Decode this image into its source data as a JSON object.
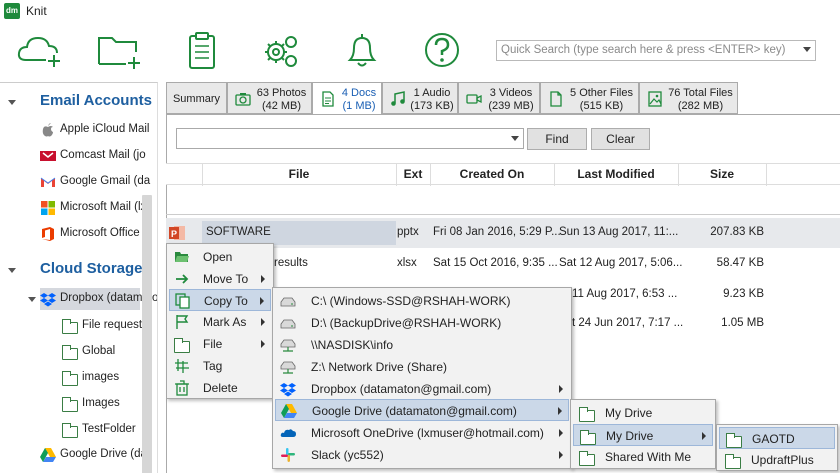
{
  "app": {
    "title": "Knit",
    "logo_text": "dm"
  },
  "search": {
    "placeholder": "Quick Search   (type search here & press <ENTER> key)"
  },
  "toolbar": {
    "icons": [
      "cloud-add-icon",
      "folder-add-icon",
      "clipboard-icon",
      "gears-icon",
      "bell-icon",
      "help-icon"
    ]
  },
  "sidebar": {
    "email_heading": "Email Accounts",
    "email_items": [
      "Apple iCloud Mail",
      "Comcast Mail (jo",
      "Google Gmail (da",
      "Microsoft Mail (lx",
      "Microsoft Office"
    ],
    "cloud_heading": "Cloud Storage",
    "dropbox": "Dropbox (datamaton",
    "folders": [
      "File requests",
      "Global",
      "images",
      "Images",
      "TestFolder"
    ],
    "google_drive": "Google Drive (dat"
  },
  "tabs": [
    {
      "l1": "Summary",
      "l2": ""
    },
    {
      "l1": "63 Photos",
      "l2": "(42 MB)"
    },
    {
      "l1": "4 Docs",
      "l2": "(1 MB)"
    },
    {
      "l1": "1 Audio",
      "l2": "(173 KB)"
    },
    {
      "l1": "3 Videos",
      "l2": "(239 MB)"
    },
    {
      "l1": "5 Other Files",
      "l2": "(515 KB)"
    },
    {
      "l1": "76 Total Files",
      "l2": "(282 MB)"
    }
  ],
  "filter": {
    "value": "",
    "find_label": "Find",
    "clear_label": "Clear"
  },
  "grid": {
    "columns": [
      "File",
      "Ext",
      "Created On",
      "Last Modified",
      "Size"
    ],
    "rows": [
      {
        "file": "SOFTWARE",
        "ext": "pptx",
        "created": "Fri 08 Jan 2016, 5:29 P...",
        "modified": "Sun 13 Aug 2017, 11:...",
        "size": "207.83 KB"
      },
      {
        "file": "results",
        "ext": "xlsx",
        "created": "Sat 15 Oct 2016, 9:35 ...",
        "modified": "Sat 12 Aug 2017, 5:06...",
        "size": "58.47 KB"
      },
      {
        "file": "",
        "ext": "",
        "created": "",
        "modified": "11 Aug 2017, 6:53 ...",
        "size": "9.23 KB"
      },
      {
        "file": "",
        "ext": "",
        "created": "",
        "modified": "t 24 Jun 2017, 7:17 ...",
        "size": "1.05 MB"
      }
    ]
  },
  "context_menu": {
    "items": [
      "Open",
      "Move To",
      "Copy To",
      "Mark As",
      "File",
      "Tag",
      "Delete"
    ]
  },
  "copy_menu": {
    "items": [
      "C:\\ (Windows-SSD@RSHAH-WORK)",
      "D:\\ (BackupDrive@RSHAH-WORK)",
      "\\\\NASDISK\\info",
      "Z:\\ Network Drive  (Share)",
      "Dropbox (datamaton@gmail.com)",
      "Google Drive (datamaton@gmail.com)",
      "Microsoft OneDrive (lxmuser@hotmail.com)",
      "Slack (yc552)"
    ]
  },
  "drive_menu": {
    "items": [
      "My Drive",
      "My Drive",
      "Shared With Me"
    ]
  },
  "mydrive_menu": {
    "items": [
      "GAOTD",
      "UpdraftPlus"
    ]
  },
  "colors": {
    "accent": "#1e5fa0",
    "icon_green": "#1f8a3c",
    "highlight": "#cbd8e8"
  }
}
